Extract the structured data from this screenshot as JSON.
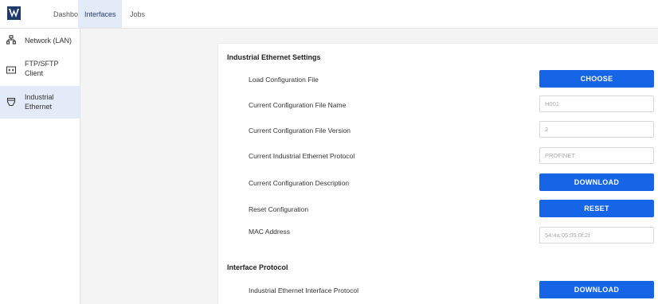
{
  "nav": {
    "logo": "logo-icon",
    "tabs": [
      {
        "label": "Dashboard"
      },
      {
        "label": "Interfaces"
      },
      {
        "label": "Jobs"
      }
    ]
  },
  "sidebar": {
    "items": [
      {
        "label": "Network (LAN)",
        "icon": "network-icon"
      },
      {
        "label": "FTP/SFTP Client",
        "icon": "ftp-icon"
      },
      {
        "label": "Industrial Ethernet",
        "icon": "ethernet-port-icon"
      }
    ]
  },
  "ethernet_settings": {
    "title": "Industrial Ethernet Settings",
    "rows": [
      {
        "label": "Load Configuration File",
        "button": "CHOOSE"
      },
      {
        "label": "Current Configuration File Name",
        "value": "H001"
      },
      {
        "label": "Current Configuration File Version",
        "value": "2"
      },
      {
        "label": "Current Industrial Ethernet Protocol",
        "value": "PROFINET"
      },
      {
        "label": "Current Configuration Description",
        "button": "DOWNLOAD"
      },
      {
        "label": "Reset Configuration",
        "button": "RESET"
      },
      {
        "label": "MAC Address",
        "value": "54:4a:05:05:0f:2f"
      }
    ]
  },
  "interface_protocol": {
    "title": "Interface Protocol",
    "rows": [
      {
        "label": "Industrial Ethernet Interface Protocol",
        "button": "DOWNLOAD"
      }
    ]
  },
  "colors": {
    "accent": "#1565e6",
    "active_bg": "#e3ebf9",
    "brand": "#1f3a6b"
  }
}
